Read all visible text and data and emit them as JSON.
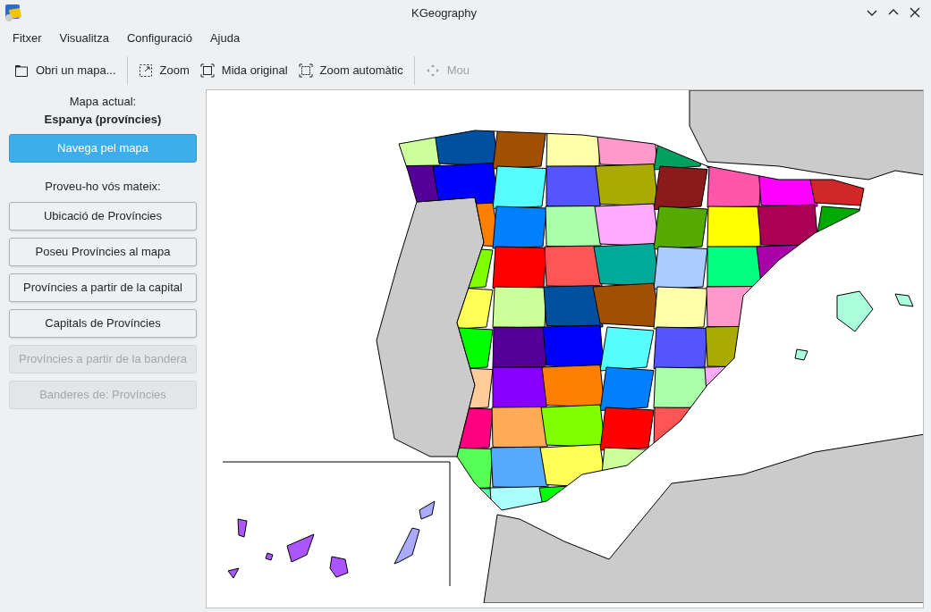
{
  "window": {
    "title": "KGeography"
  },
  "menu": [
    "Fitxer",
    "Visualitza",
    "Configuració",
    "Ajuda"
  ],
  "toolbar": [
    {
      "kind": "folder",
      "label": "Obri un mapa...",
      "disabled": false,
      "separator_before": false
    },
    {
      "kind": "zoom",
      "label": "Zoom",
      "disabled": false,
      "separator_before": true
    },
    {
      "kind": "original",
      "label": "Mida original",
      "disabled": false,
      "separator_before": false
    },
    {
      "kind": "autozoom",
      "label": "Zoom automàtic",
      "disabled": false,
      "separator_before": false
    },
    {
      "kind": "move",
      "label": "Mou",
      "disabled": true,
      "separator_before": true
    }
  ],
  "sidebar": {
    "current_map_label": "Mapa actual:",
    "current_map": "Espanya (províncies)",
    "browse_button": "Navega pel mapa",
    "quiz_heading": "Proveu-ho vós mateix:",
    "quiz_buttons": [
      {
        "label": "Ubicació de Províncies",
        "disabled": false
      },
      {
        "label": "Poseu Províncies al mapa",
        "disabled": false
      },
      {
        "label": "Províncies a partir de la capital",
        "disabled": false
      },
      {
        "label": "Capitals de Províncies",
        "disabled": false
      },
      {
        "label": "Províncies a partir de la bandera",
        "disabled": true
      },
      {
        "label": "Banderes de: Províncies",
        "disabled": true
      }
    ]
  }
}
